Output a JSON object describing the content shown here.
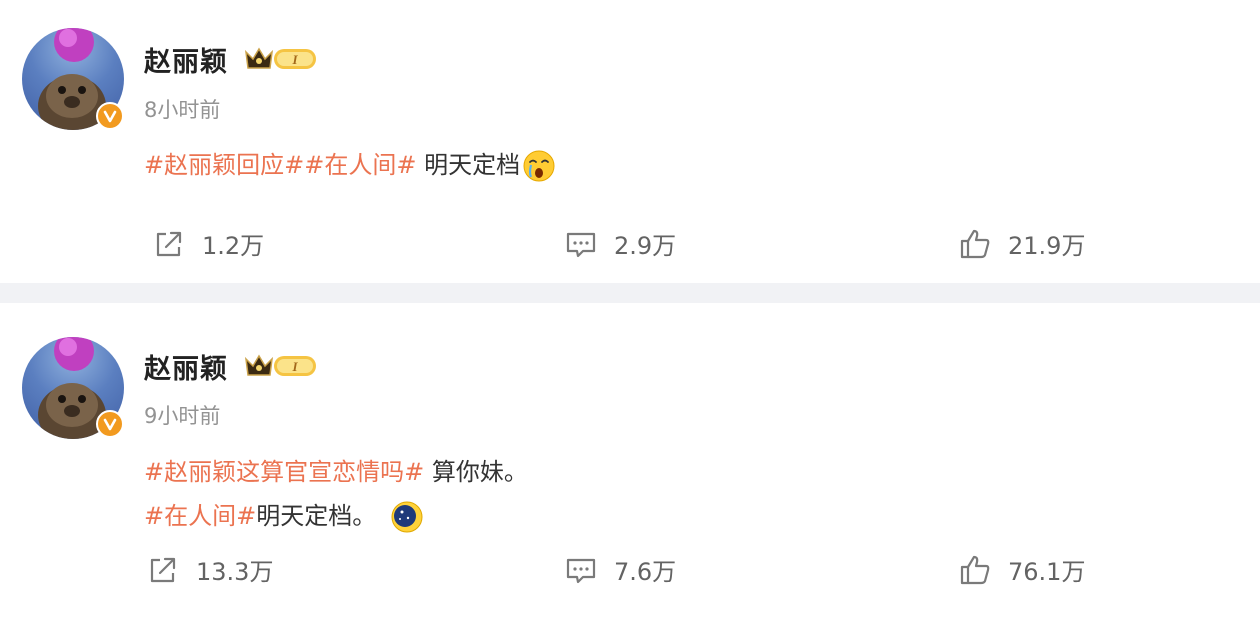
{
  "posts": [
    {
      "user": {
        "name": "赵丽颖",
        "level": "I"
      },
      "time": "8小时前",
      "lines": [
        {
          "topics": [
            "#赵丽颖回应#",
            "#在人间#"
          ],
          "text": " 明天定档",
          "emoji": "crying-face-emoji"
        }
      ],
      "actions": {
        "share": "1.2万",
        "comment": "2.9万",
        "like": "21.9万"
      }
    },
    {
      "user": {
        "name": "赵丽颖",
        "level": "I"
      },
      "time": "9小时前",
      "lines": [
        {
          "topics": [
            "#赵丽颖这算官宣恋情吗#"
          ],
          "text": " 算你妹。"
        },
        {
          "topics": [
            "#在人间#"
          ],
          "text": "明天定档。",
          "emoji": "moon-night-emoji"
        }
      ],
      "actions": {
        "share": "13.3万",
        "comment": "7.6万",
        "like": "76.1万"
      }
    }
  ],
  "colors": {
    "topic": "#eb7350",
    "verified": "#f29a1f",
    "divider": "#f1f2f5",
    "meta": "#939393"
  },
  "icons": [
    "share-icon",
    "comment-icon",
    "like-icon",
    "verified-icon",
    "crown-badge-icon"
  ]
}
